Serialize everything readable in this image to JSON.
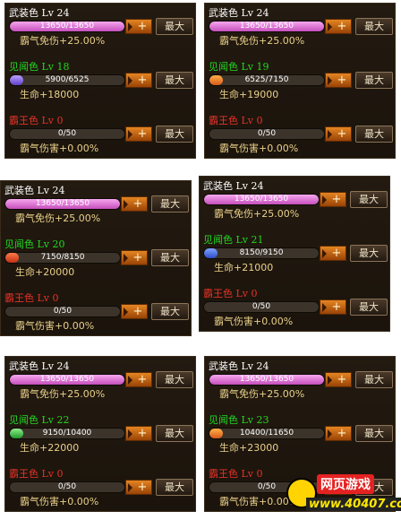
{
  "buttons": {
    "plus": "+",
    "max": "最大"
  },
  "colors": {
    "title_armament": "#ffffff",
    "title_observation": "#22d822",
    "title_conqueror": "#e63228",
    "stat_text": "#e9d08a",
    "bar_track": "#3c342b"
  },
  "panels": [
    {
      "sections": [
        {
          "title": "武装色 Lv 24",
          "title_color": "#ffffff",
          "bar_text": "13650/13650",
          "progress": 1.0,
          "fill": "pink",
          "stat": "霸气免伤+25.00%"
        },
        {
          "title": "见闻色 Lv 18",
          "title_color": "#22d822",
          "bar_text": "5900/6525",
          "progress": 0.12,
          "fill": "purple",
          "stat": "生命+18000"
        },
        {
          "title": "霸王色 Lv 0",
          "title_color": "#e63228",
          "bar_text": "0/50",
          "progress": 0,
          "fill": "red",
          "stat": "霸气伤害+0.00%"
        }
      ]
    },
    {
      "sections": [
        {
          "title": "武装色 Lv 24",
          "title_color": "#ffffff",
          "bar_text": "13650/13650",
          "progress": 1.0,
          "fill": "pink",
          "stat": "霸气免伤+25.00%"
        },
        {
          "title": "见闻色 Lv 19",
          "title_color": "#22d822",
          "bar_text": "6525/7150",
          "progress": 0.12,
          "fill": "orange",
          "stat": "生命+19000"
        },
        {
          "title": "霸王色 Lv 0",
          "title_color": "#e63228",
          "bar_text": "0/50",
          "progress": 0,
          "fill": "red",
          "stat": "霸气伤害+0.00%"
        }
      ]
    },
    {
      "sections": [
        {
          "title": "武装色 Lv 24",
          "title_color": "#ffffff",
          "bar_text": "13650/13650",
          "progress": 1.0,
          "fill": "pink",
          "stat": "霸气免伤+25.00%"
        },
        {
          "title": "见闻色 Lv 20",
          "title_color": "#22d822",
          "bar_text": "7150/8150",
          "progress": 0.12,
          "fill": "red",
          "stat": "生命+20000"
        },
        {
          "title": "霸王色 Lv 0",
          "title_color": "#e63228",
          "bar_text": "0/50",
          "progress": 0,
          "fill": "red",
          "stat": "霸气伤害+0.00%"
        }
      ]
    },
    {
      "sections": [
        {
          "title": "武装色 Lv 24",
          "title_color": "#ffffff",
          "bar_text": "13650/13650",
          "progress": 1.0,
          "fill": "pink",
          "stat": "霸气免伤+25.00%"
        },
        {
          "title": "见闻色 Lv 21",
          "title_color": "#22d822",
          "bar_text": "8150/9150",
          "progress": 0.12,
          "fill": "blue",
          "stat": "生命+21000"
        },
        {
          "title": "霸王色 Lv 0",
          "title_color": "#e63228",
          "bar_text": "0/50",
          "progress": 0,
          "fill": "red",
          "stat": "霸气伤害+0.00%"
        }
      ]
    },
    {
      "sections": [
        {
          "title": "武装色 Lv 24",
          "title_color": "#ffffff",
          "bar_text": "13650/13650",
          "progress": 1.0,
          "fill": "pink",
          "stat": "霸气免伤+25.00%"
        },
        {
          "title": "见闻色 Lv 22",
          "title_color": "#22d822",
          "bar_text": "9150/10400",
          "progress": 0.12,
          "fill": "green",
          "stat": "生命+22000"
        },
        {
          "title": "霸王色 Lv 0",
          "title_color": "#e63228",
          "bar_text": "0/50",
          "progress": 0,
          "fill": "red",
          "stat": "霸气伤害+0.00%"
        }
      ]
    },
    {
      "sections": [
        {
          "title": "武装色 Lv 24",
          "title_color": "#ffffff",
          "bar_text": "13650/13650",
          "progress": 1.0,
          "fill": "pink",
          "stat": "霸气免伤+25.00%"
        },
        {
          "title": "见闻色 Lv 23",
          "title_color": "#22d822",
          "bar_text": "10400/11650",
          "progress": 0.12,
          "fill": "orange",
          "stat": "生命+23000"
        },
        {
          "title": "霸王色 Lv 0",
          "title_color": "#e63228",
          "bar_text": "0/50",
          "progress": 0,
          "fill": "red",
          "stat": "霸气伤害+0.00%"
        }
      ]
    }
  ],
  "watermark": {
    "line1": "网页游戏",
    "line2": "www.40407.com"
  }
}
